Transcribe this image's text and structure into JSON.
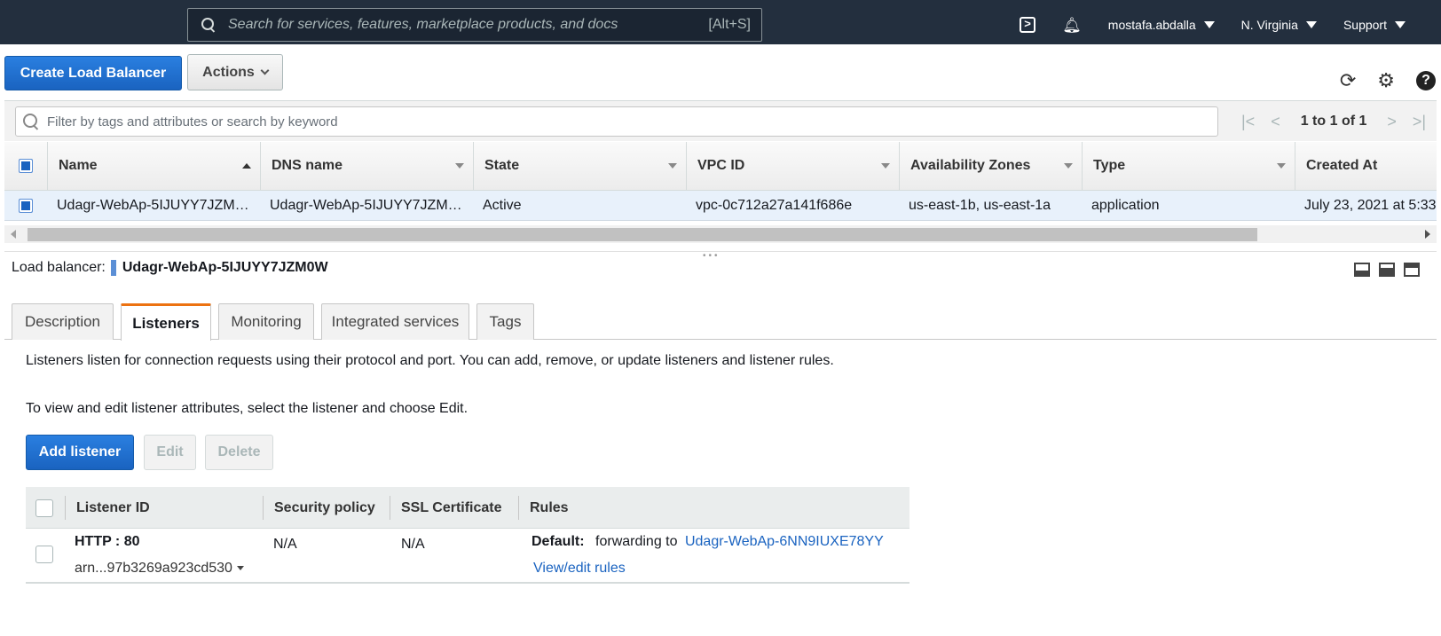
{
  "nav": {
    "search_placeholder": "Search for services, features, marketplace products, and docs",
    "search_shortcut": "[Alt+S]",
    "user": "mostafa.abdalla",
    "region": "N. Virginia",
    "support": "Support"
  },
  "toolbar": {
    "create_label": "Create Load Balancer",
    "actions_label": "Actions"
  },
  "filter": {
    "placeholder": "Filter by tags and attributes or search by keyword",
    "pagination": "1 to 1 of 1"
  },
  "table": {
    "columns": [
      "Name",
      "DNS name",
      "State",
      "VPC ID",
      "Availability Zones",
      "Type",
      "Created At"
    ],
    "rows": [
      {
        "name": "Udagr-WebAp-5IJUYY7JZM…",
        "dns": "Udagr-WebAp-5IJUYY7JZM…",
        "state": "Active",
        "vpc": "vpc-0c712a27a141f686e",
        "azs": "us-east-1b, us-east-1a",
        "type": "application",
        "created": "July 23, 2021 at 5:33"
      }
    ]
  },
  "detail": {
    "label": "Load balancer:",
    "name": "Udagr-WebAp-5IJUYY7JZM0W",
    "tabs": [
      "Description",
      "Listeners",
      "Monitoring",
      "Integrated services",
      "Tags"
    ],
    "active_tab": "Listeners",
    "info1": "Listeners listen for connection requests using their protocol and port. You can add, remove, or update listeners and listener rules.",
    "info2": "To view and edit listener attributes, select the listener and choose Edit.",
    "add_label": "Add listener",
    "edit_label": "Edit",
    "delete_label": "Delete"
  },
  "listeners": {
    "columns": [
      "Listener ID",
      "Security policy",
      "SSL Certificate",
      "Rules"
    ],
    "rows": [
      {
        "id": "HTTP : 80",
        "arn": "arn...97b3269a923cd530",
        "security_policy": "N/A",
        "ssl_certificate": "N/A",
        "default_label": "Default:",
        "forward_text": "forwarding to",
        "target": "Udagr-WebAp-6NN9IUXE78YY",
        "rules_link": "View/edit rules"
      }
    ]
  },
  "colors": {
    "nav_bg": "#232f3e",
    "primary": "#1a63c0",
    "active_tab_accent": "#ec7211",
    "selected_row": "#e8f1fb"
  }
}
